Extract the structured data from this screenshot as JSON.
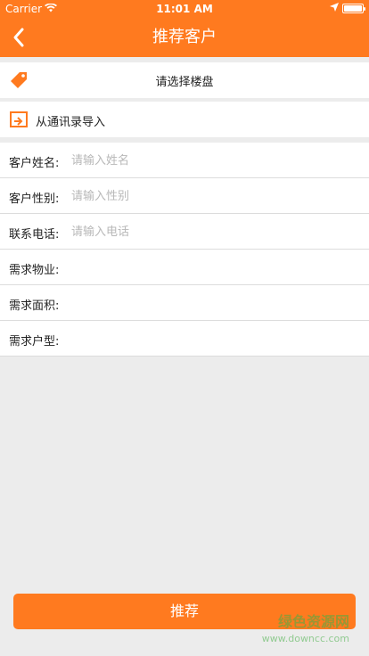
{
  "status_bar": {
    "carrier": "Carrier",
    "time": "11:01 AM"
  },
  "nav": {
    "title": "推荐客户",
    "back_icon": "chevron-left-icon"
  },
  "select_building": {
    "label": "请选择楼盘",
    "icon": "tag-icon"
  },
  "import_contacts": {
    "label": "从通讯录导入",
    "icon": "import-icon"
  },
  "form": {
    "fields": [
      {
        "label": "客户姓名:",
        "placeholder": "请输入姓名",
        "value": ""
      },
      {
        "label": "客户性别:",
        "placeholder": "请输入性别",
        "value": ""
      },
      {
        "label": "联系电话:",
        "placeholder": "请输入电话",
        "value": ""
      },
      {
        "label": "需求物业:",
        "placeholder": "",
        "value": ""
      },
      {
        "label": "需求面积:",
        "placeholder": "",
        "value": ""
      },
      {
        "label": "需求户型:",
        "placeholder": "",
        "value": ""
      }
    ]
  },
  "submit_label": "推荐",
  "watermark": {
    "title": "绿色资源网",
    "url": "www.downcc.com"
  },
  "colors": {
    "accent": "#ff7a1f",
    "background": "#ececec",
    "placeholder": "#b8b8b8"
  }
}
